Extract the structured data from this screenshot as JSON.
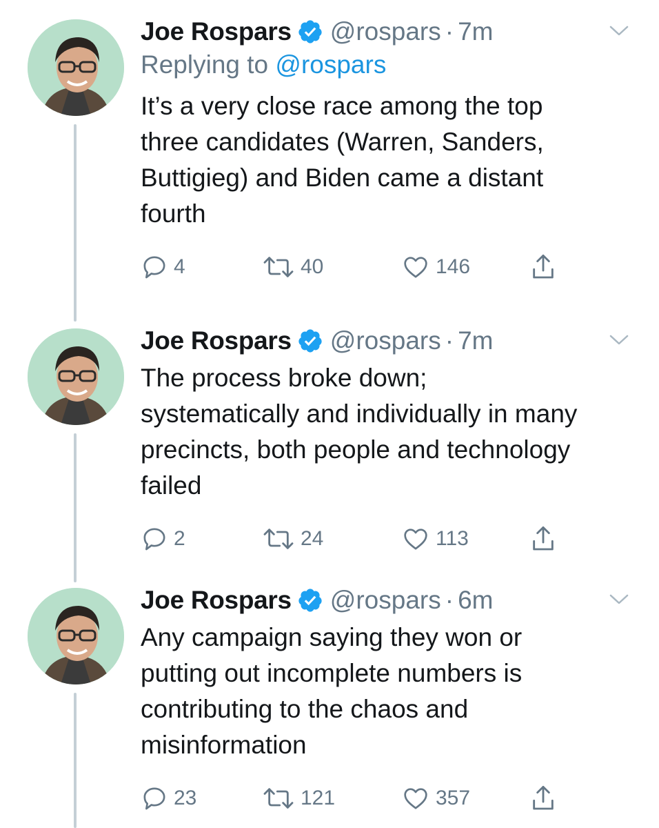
{
  "colors": {
    "text": "#14171a",
    "muted": "#657786",
    "link": "#1b95e0",
    "thread_line": "#c4cfd6",
    "avatar_bg": "#b7dfca"
  },
  "tweets": [
    {
      "author": "Joe Rospars",
      "verified": true,
      "handle": "@rospars",
      "separator": "·",
      "time": "7m",
      "replying_prefix": "Replying to",
      "replying_to": "@rospars",
      "text": "It’s a very close race among the top\nthree candidates (Warren, Sanders,\nButtigieg) and Biden came a distant\nfourth",
      "replies": "4",
      "retweets": "40",
      "likes": "146"
    },
    {
      "author": "Joe Rospars",
      "verified": true,
      "handle": "@rospars",
      "separator": "·",
      "time": "7m",
      "text": "The process broke down;\nsystematically and individually in many\nprecincts, both people and technology\nfailed",
      "replies": "2",
      "retweets": "24",
      "likes": "113"
    },
    {
      "author": "Joe Rospars",
      "verified": true,
      "handle": "@rospars",
      "separator": "·",
      "time": "6m",
      "text": "Any campaign saying they won or\nputting out incomplete numbers is\ncontributing to the chaos and\nmisinformation",
      "replies": "23",
      "retweets": "121",
      "likes": "357"
    }
  ],
  "icons": {
    "reply": "reply-icon",
    "retweet": "retweet-icon",
    "like": "heart-icon",
    "share": "share-icon",
    "verified": "verified-badge-icon",
    "menu": "chevron-down-icon"
  }
}
